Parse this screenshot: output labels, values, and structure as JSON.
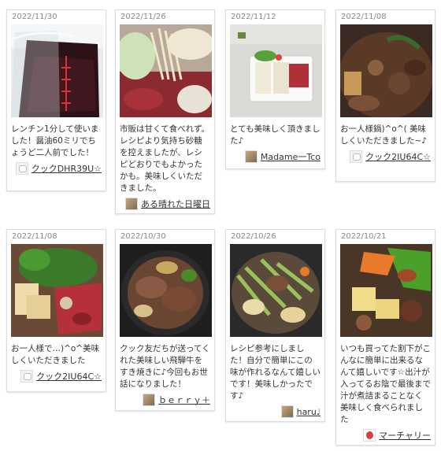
{
  "cards": [
    {
      "date": "2022/11/30",
      "text": "レンチン1分して使いました！醤油60ミリでちょうど二人前でした！",
      "author": "クックDHR39U☆"
    },
    {
      "date": "2022/11/26",
      "text": "市販は甘くて食べれず。レシピより気持ち砂糖を控えましたが、レシピどおりでもよかったかも。美味しくいただきました。",
      "author": "ある晴れた日曜日"
    },
    {
      "date": "2022/11/12",
      "text": "とても美味しく頂きました♪",
      "author": "Madame一Tco"
    },
    {
      "date": "2022/11/08",
      "text": "お一人様鍋)^o^( 美味しくいただきました~♪",
      "author": "クック2IU64C☆"
    },
    {
      "date": "2022/11/08",
      "text": "お一人様で…)^o^美味しくいただきました",
      "author": "クック2IU64C☆"
    },
    {
      "date": "2022/10/30",
      "text": "クック友だちが送ってくれた美味しい飛騨牛をすき焼きに♪今回もお世話になりました！",
      "author": "ｂｅｒｒｙ＋"
    },
    {
      "date": "2022/10/26",
      "text": "レシピ参考にしました！自分で簡単にこの味が作れるなんて嬉しいです！美味しかったです♪",
      "author": "haru♩"
    },
    {
      "date": "2022/10/21",
      "text": "いつも買ってた割下がこんなに簡単に出来るなんて嬉しいです☆出汁が入ってるお陰で最後まで汁が煮詰まることなく美味しく食べられました",
      "author": "マーチャリー"
    }
  ]
}
